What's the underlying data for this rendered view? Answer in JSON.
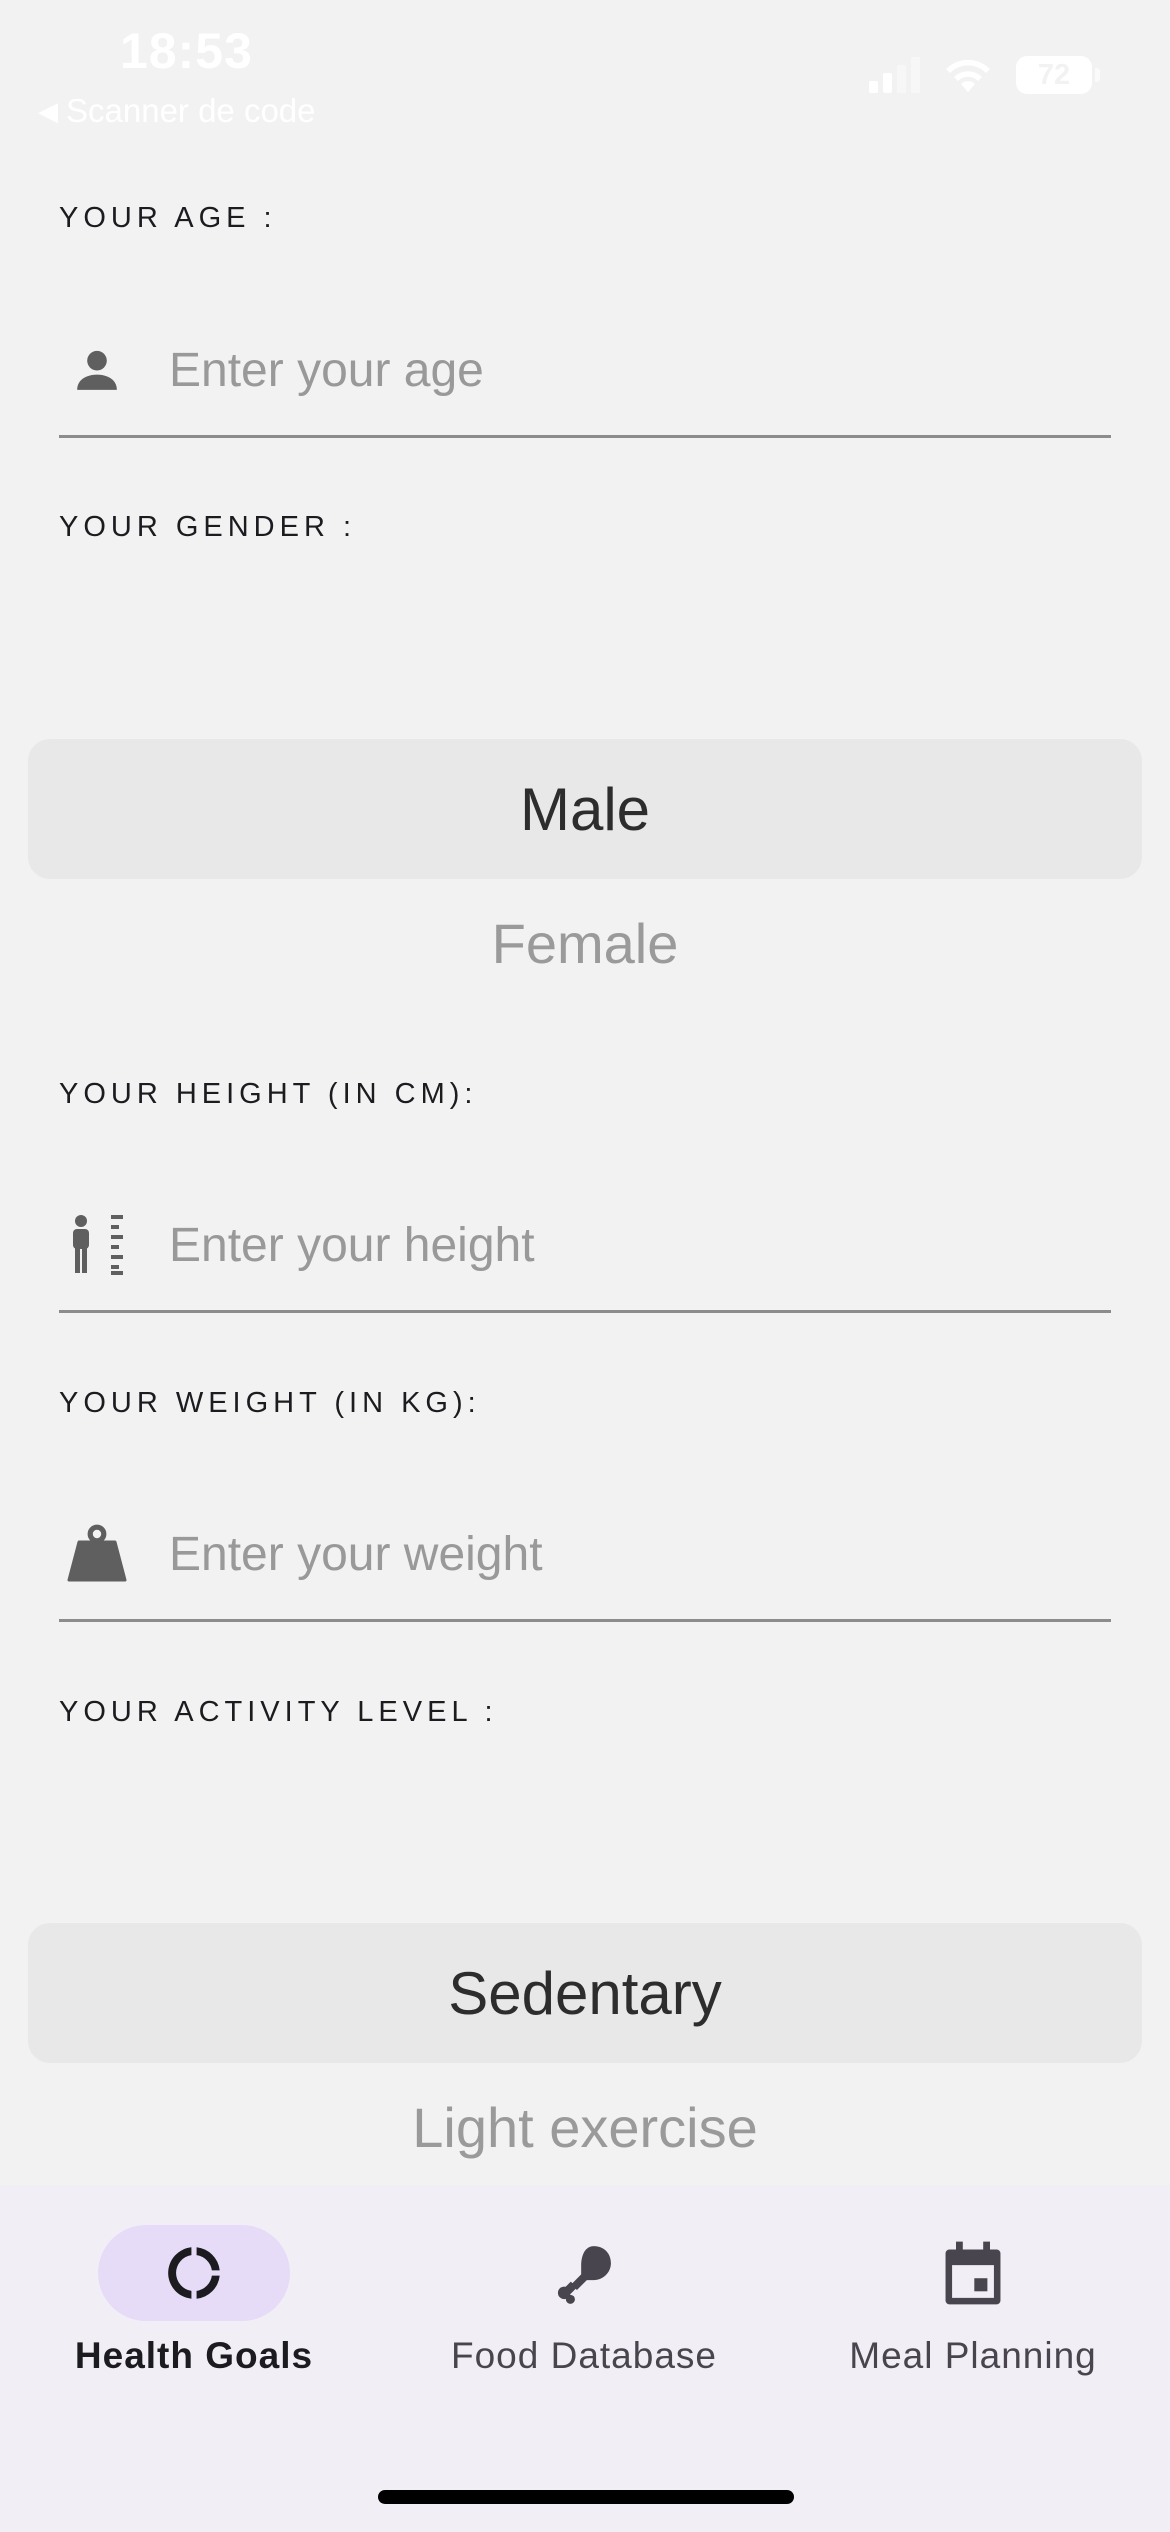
{
  "status_bar": {
    "time": "18:53",
    "back_label": "Scanner de code",
    "back_icon": "back-triangle-icon",
    "battery": "72",
    "icons": [
      "signal-icon",
      "wifi-icon",
      "battery-icon"
    ]
  },
  "form": {
    "age": {
      "label": "YOUR AGE :",
      "placeholder": "Enter your age",
      "value": "",
      "icon": "person-icon"
    },
    "gender": {
      "label": "YOUR GENDER :",
      "options": [
        "Male",
        "Female"
      ],
      "selected": "Male"
    },
    "height": {
      "label": "YOUR HEIGHT (IN CM):",
      "placeholder": "Enter your height",
      "value": "",
      "icon": "height-icon"
    },
    "weight": {
      "label": "YOUR WEIGHT (IN KG):",
      "placeholder": "Enter your weight",
      "value": "",
      "icon": "weight-icon"
    },
    "activity": {
      "label": "YOUR ACTIVITY LEVEL :",
      "options": [
        "Sedentary",
        "Light exercise"
      ],
      "selected": "Sedentary"
    }
  },
  "bottom_nav": {
    "items": [
      {
        "label": "Health Goals",
        "icon": "donut-chart-icon",
        "active": true
      },
      {
        "label": "Food Database",
        "icon": "drumstick-icon",
        "active": false
      },
      {
        "label": "Meal Planning",
        "icon": "calendar-icon",
        "active": false
      }
    ]
  },
  "colors": {
    "background": "#f2f2f2",
    "nav_background": "#f2eef5",
    "active_pill": "#e6dcf8",
    "picker_selected": "#e8e8e8",
    "placeholder": "#999999",
    "icon": "#5f5f5f"
  }
}
